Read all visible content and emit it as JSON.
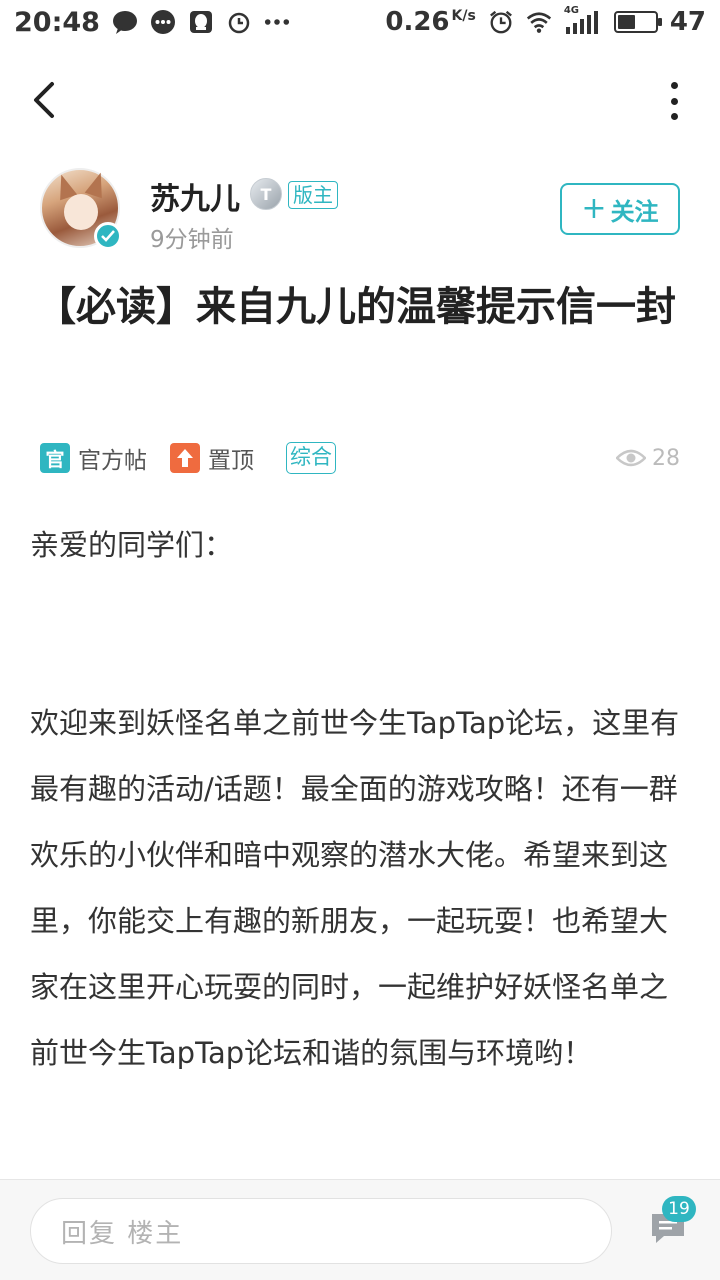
{
  "status_bar": {
    "time": "20:48",
    "net_speed": "0.26",
    "net_speed_unit": "K/s",
    "network_label": "4G",
    "battery": "47",
    "battery_level": 0.47
  },
  "header": {
    "back_icon": "chevron-left-icon",
    "more_icon": "more-vertical-icon"
  },
  "author": {
    "name": "苏九儿",
    "level_badge": "T",
    "role_badge": "版主",
    "time": "9分钟前",
    "follow_label": "关注",
    "follow_plus": "+"
  },
  "post": {
    "title": "【必读】来自九儿的温馨提示信一封",
    "tags": {
      "official_icon": "官",
      "official_label": "官方帖",
      "pinned_label": "置顶",
      "category": "综合"
    },
    "views": "28",
    "greeting": "亲爱的同学们：",
    "body": "欢迎来到妖怪名单之前世今生TapTap论坛，这里有最有趣的活动/话题！最全面的游戏攻略！还有一群欢乐的小伙伴和暗中观察的潜水大佬。希望来到这里，你能交上有趣的新朋友，一起玩耍！也希望大家在这里开心玩耍的同时，一起维护好妖怪名单之前世今生TapTap论坛和谐的氛围与环境哟！"
  },
  "reply_bar": {
    "placeholder": "回复  楼主",
    "comment_count": "19"
  },
  "colors": {
    "accent": "#2fb6c1",
    "pinned": "#ef6b3f",
    "text": "#333333",
    "muted": "#9a9a9a"
  }
}
